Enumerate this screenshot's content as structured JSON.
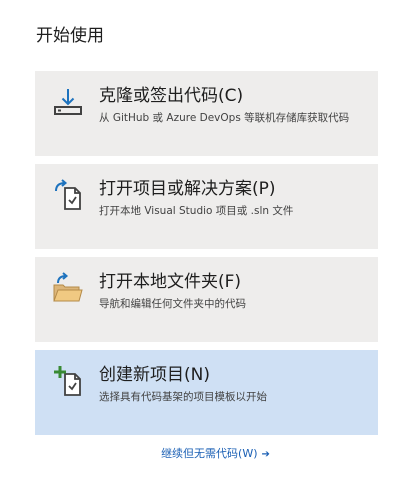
{
  "section_title": "开始使用",
  "cards": [
    {
      "title": "克隆或签出代码(C)",
      "description": "从 GitHub 或 Azure DevOps 等联机存储库获取代码",
      "icon": "clone-download-icon"
    },
    {
      "title": "打开项目或解决方案(P)",
      "description": "打开本地 Visual Studio 项目或 .sln 文件",
      "icon": "open-project-icon"
    },
    {
      "title": "打开本地文件夹(F)",
      "description": "导航和编辑任何文件夹中的代码",
      "icon": "open-folder-icon"
    },
    {
      "title": "创建新项目(N)",
      "description": "选择具有代码基架的项目模板以开始",
      "icon": "new-project-icon",
      "selected": true
    }
  ],
  "continue_link": {
    "label": "继续但无需代码(W)",
    "arrow": "➔"
  },
  "colors": {
    "card_bg": "#eeedec",
    "card_selected_bg": "#cfe0f4",
    "link": "#1a5fb4",
    "icon_blue": "#1e73be",
    "folder_yellow": "#dcb67a",
    "plus_green": "#388a34"
  }
}
